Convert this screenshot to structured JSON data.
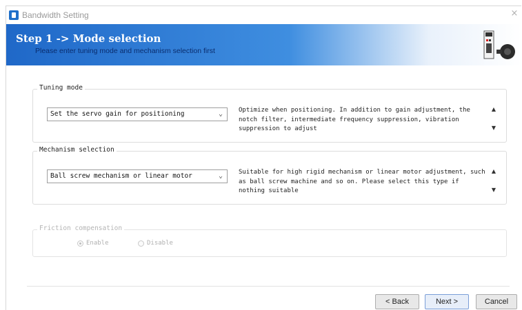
{
  "window": {
    "title": "Bandwidth Setting",
    "close_glyph": "×"
  },
  "banner": {
    "step_title": "Step 1 -> Mode selection",
    "subtitle": "Please enter tuning mode and mechanism selection first",
    "graphic": "servo-drive-and-motor"
  },
  "tuning": {
    "group_label": "Tuning mode",
    "selected": "Set the servo gain for positioning",
    "description": "Optimize when positioning. In addition to gain adjustment, the notch filter, intermediate frequency suppression, vibration suppression to adjust"
  },
  "mechanism": {
    "group_label": "Mechanism selection",
    "selected": "Ball screw mechanism or linear motor",
    "description": "Suitable for high rigid mechanism or linear motor adjustment, such as ball screw machine and so on. Please select this type if nothing suitable"
  },
  "friction": {
    "group_label": "Friction compensation",
    "enable_label": "Enable",
    "disable_label": "Disable",
    "selected": "Enable",
    "disabled_state": true
  },
  "buttons": {
    "back": "< Back",
    "next": "Next >",
    "cancel": "Cancel"
  },
  "icons": {
    "dropdown": "chevron-down-icon",
    "scroll_up": "▲",
    "scroll_down": "▼"
  },
  "colors": {
    "banner_start": "#1f68c8",
    "banner_mid": "#3f8ee0",
    "title_text": "#9a9a9a"
  }
}
